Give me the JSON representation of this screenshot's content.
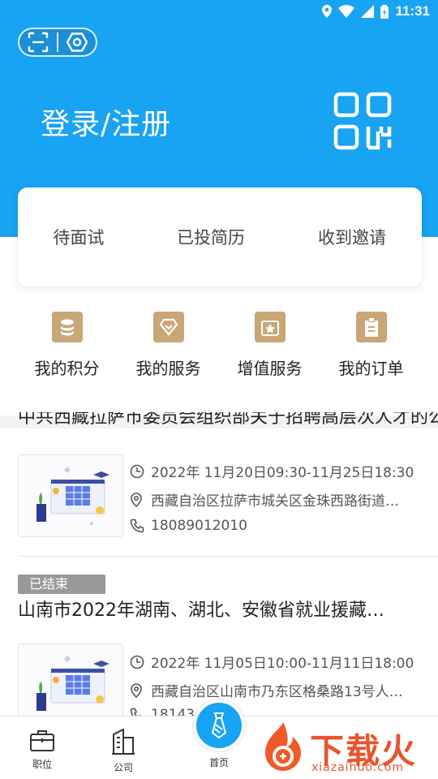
{
  "status_bar": {
    "time": "11:31"
  },
  "header": {
    "title": "登录/注册",
    "scan_icon": "scan-icon",
    "settings_icon": "settings-icon",
    "qr_icon": "qr-code-icon",
    "background_color": "#18a3f3"
  },
  "stats_card": {
    "items": [
      {
        "label": "待面试"
      },
      {
        "label": "已投简历"
      },
      {
        "label": "收到邀请"
      }
    ]
  },
  "menu": {
    "items": [
      {
        "label": "我的积分",
        "icon": "coins-icon"
      },
      {
        "label": "我的服务",
        "icon": "diamond-icon"
      },
      {
        "label": "增值服务",
        "icon": "star-icon"
      },
      {
        "label": "我的订单",
        "icon": "clipboard-icon"
      }
    ],
    "icon_color": "#c9a676"
  },
  "events": [
    {
      "title": "中共西藏拉萨市委员会组织部关于招聘高层次人才的公告",
      "time": "2022年 11月20日09:30-11月25日18:30",
      "address": "西藏自治区拉萨市城关区金珠西路街道…",
      "phone": "18089012010"
    },
    {
      "status": "已结束",
      "title": "山南市2022年湖南、湖北、安徽省就业援藏…",
      "time": "2022年 11月05日10:00-11月11日18:00",
      "address": "西藏自治区山南市乃东区格桑路13号人…",
      "phone": "18143"
    }
  ],
  "tabbar": {
    "items": [
      {
        "label": "职位",
        "icon": "briefcase-icon"
      },
      {
        "label": "公司",
        "icon": "building-icon"
      },
      {
        "label": "首页",
        "icon": "tie-icon"
      }
    ]
  },
  "watermark": {
    "text": "下载火",
    "sub": "xiazaihuo.com"
  }
}
